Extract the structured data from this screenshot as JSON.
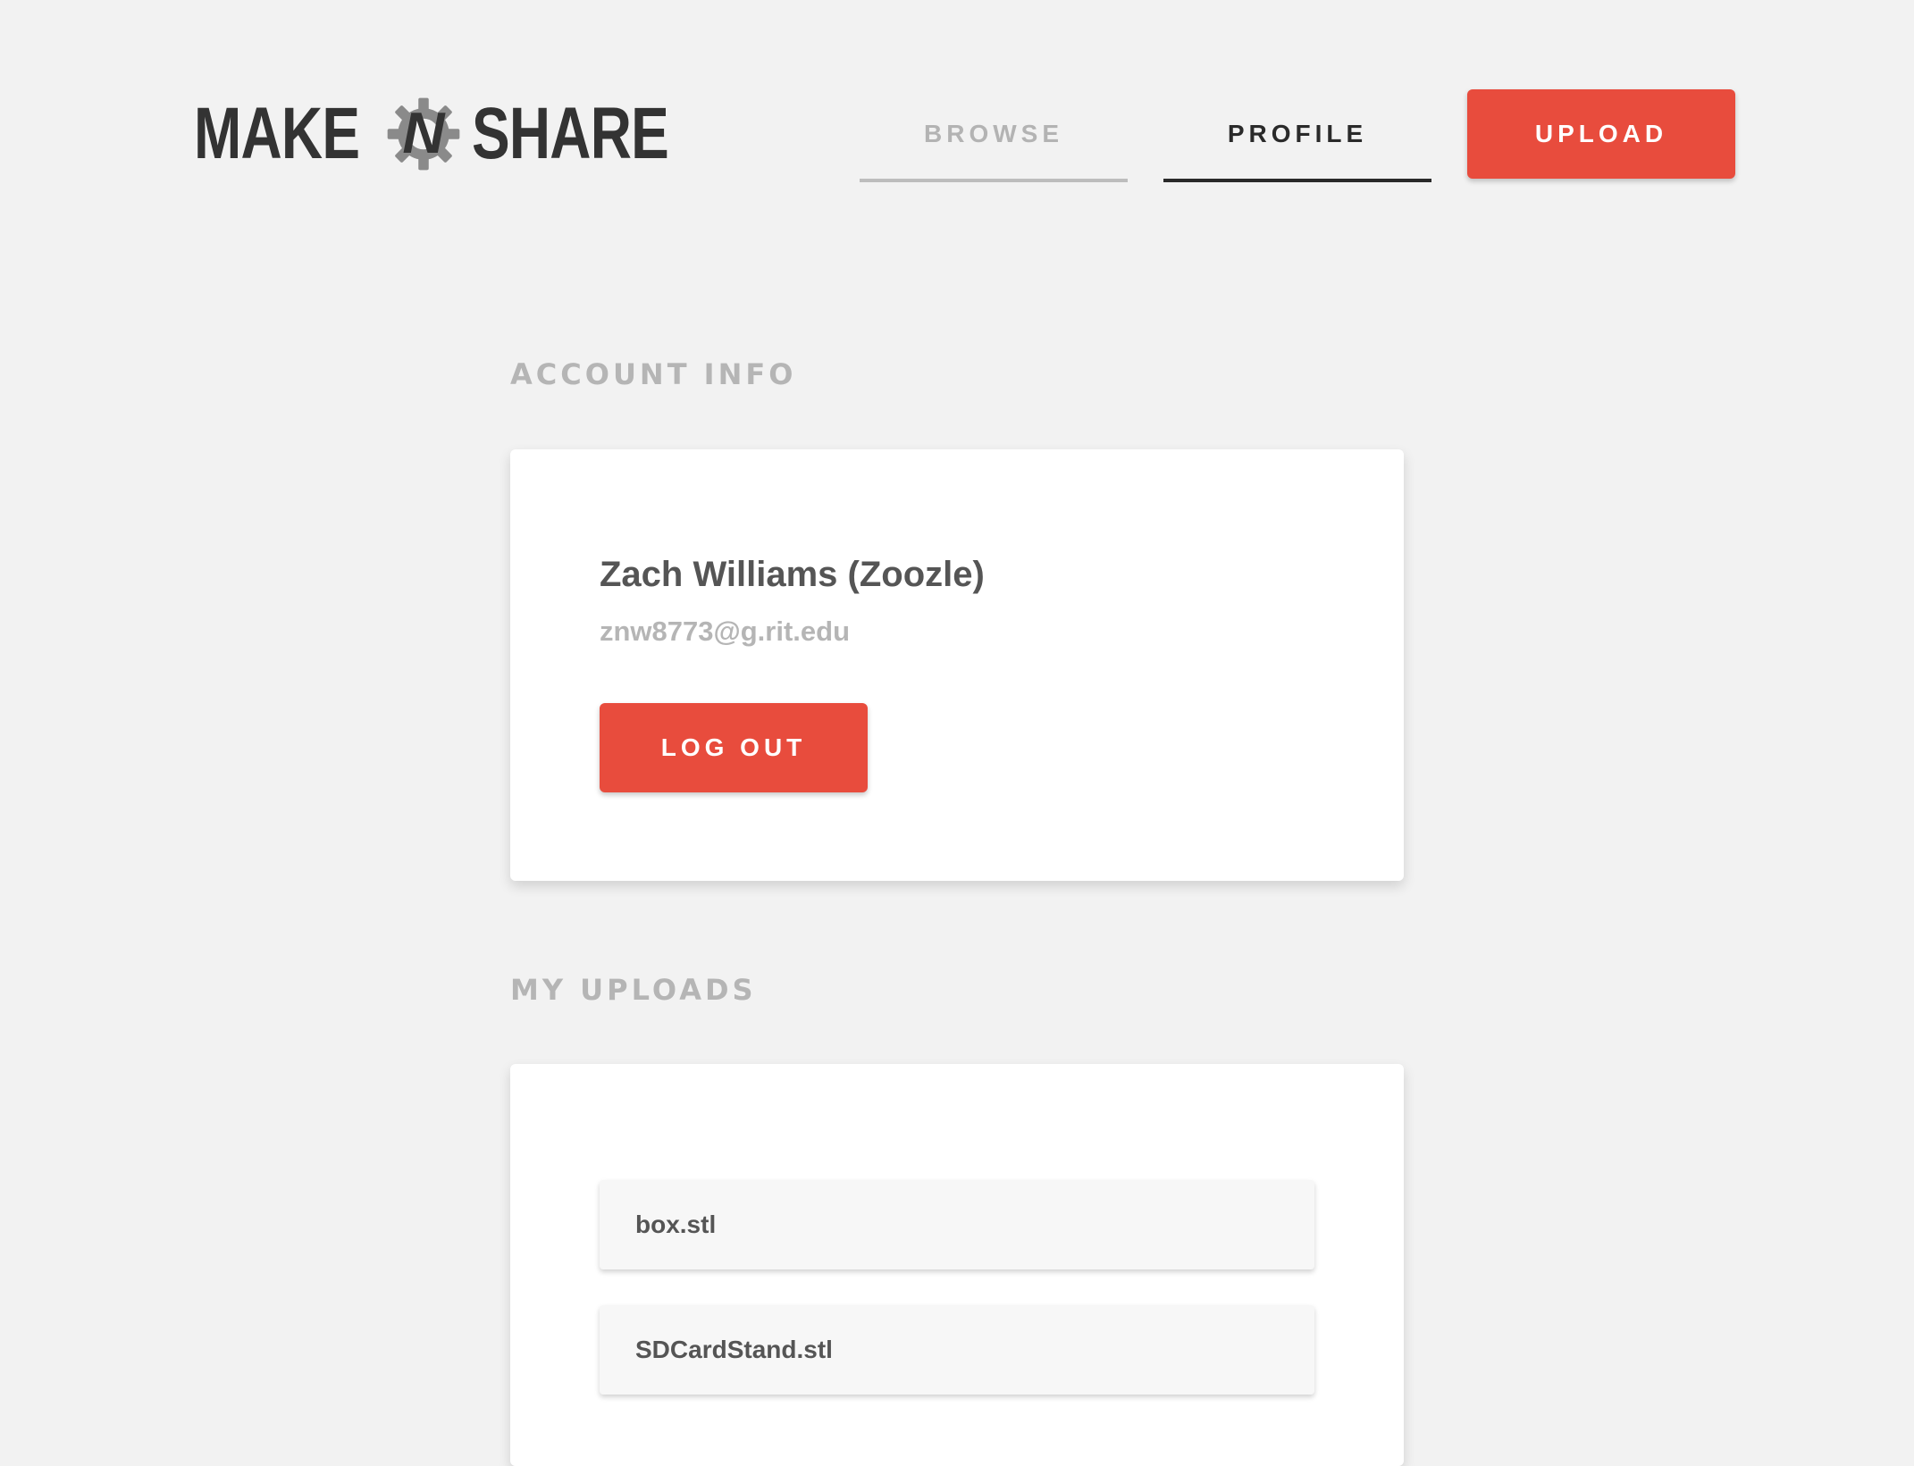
{
  "header": {
    "logo": {
      "left_word": "MAKE",
      "middle_letter": "N",
      "right_word": "SHARE"
    },
    "nav": {
      "browse_label": "BROWSE",
      "profile_label": "PROFILE",
      "upload_label": "UPLOAD",
      "active_tab": "PROFILE"
    }
  },
  "account": {
    "heading": "ACCOUNT INFO",
    "name": "Zach Williams (Zoozle)",
    "email": "znw8773@g.rit.edu",
    "logout_label": "LOG OUT"
  },
  "uploads": {
    "heading": "MY UPLOADS",
    "items": [
      {
        "filename": "box.stl"
      },
      {
        "filename": "SDCardStand.stl"
      }
    ]
  },
  "colors": {
    "accent": "#e84c3d",
    "background": "#f2f2f2",
    "heading_gray": "#b5b5b5",
    "text_dark": "#555555"
  }
}
